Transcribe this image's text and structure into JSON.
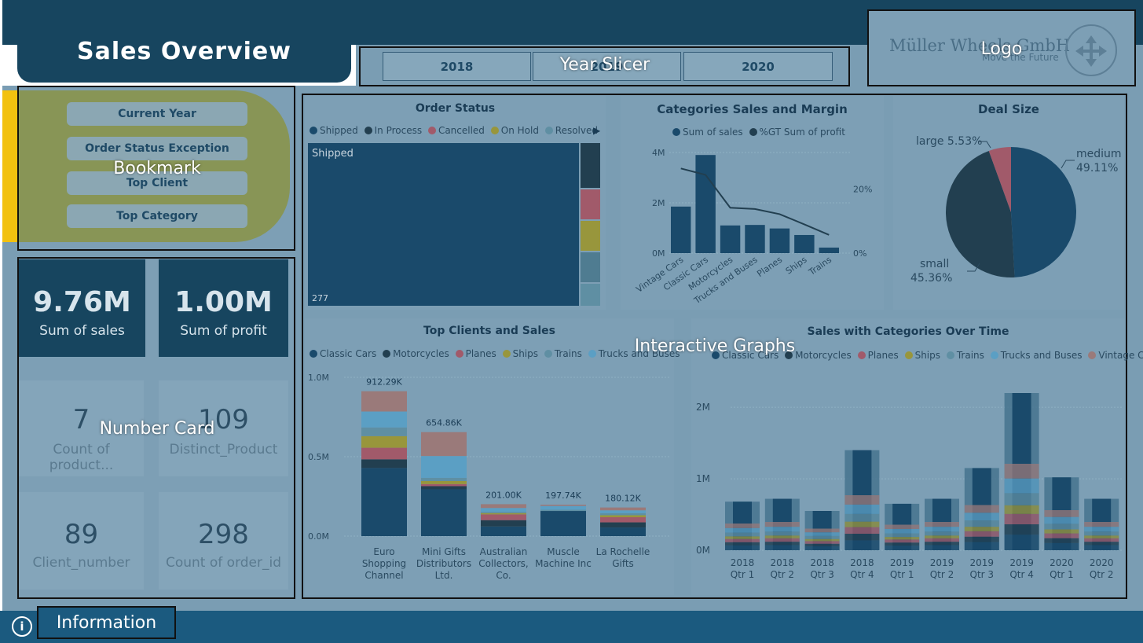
{
  "header": {
    "title": "Sales Overview"
  },
  "year_slicer": {
    "buttons": [
      "2018",
      "2019",
      "2020"
    ],
    "annotation": "Year Slicer"
  },
  "logo": {
    "company": "Müller Wheels GmbH",
    "tagline": "Move the Future",
    "annotation": "Logo"
  },
  "bookmarks": {
    "buttons": [
      "Current Year",
      "Order Status Exception",
      "Top Client",
      "Top Category"
    ],
    "annotation": "Bookmark"
  },
  "cards": {
    "annotation": "Number Card",
    "items": [
      {
        "value": "9.76M",
        "label": "Sum of sales"
      },
      {
        "value": "1.00M",
        "label": "Sum of profit"
      },
      {
        "value": "7",
        "label": "Count of product..."
      },
      {
        "value": "109",
        "label": "Distinct_Product"
      },
      {
        "value": "89",
        "label": "Client_number"
      },
      {
        "value": "298",
        "label": "Count of order_id"
      }
    ]
  },
  "graphs_annotation": "Interactive Graphs",
  "footer": {
    "info_label": "Information",
    "info_icon": "info-icon"
  },
  "colors": {
    "dark_blue": "#17455f",
    "accent_yellow": "#f2c10f",
    "shipped": "#1a4a6b",
    "in_process": "#223f50",
    "cancelled": "#a15a6a",
    "on_hold": "#98963c",
    "resolved": "#5f8fa3"
  },
  "chart_data": [
    {
      "type": "treemap",
      "title": "Order Status",
      "legend": [
        "Shipped",
        "In Process",
        "Cancelled",
        "On Hold",
        "Resolved"
      ],
      "labels": {
        "main": "Shipped",
        "count": "277"
      }
    },
    {
      "type": "bar",
      "title": "Categories Sales and Margin",
      "legend": [
        "Sum of sales",
        "%GT Sum of profit"
      ],
      "categories": [
        "Vintage Cars",
        "Classic Cars",
        "Motorcycles",
        "Trucks and Buses",
        "Planes",
        "Ships",
        "Trains"
      ],
      "series": [
        {
          "name": "Sum of sales",
          "values": [
            1.85,
            3.9,
            1.1,
            1.12,
            0.98,
            0.72,
            0.22
          ]
        },
        {
          "name": "%GT Sum of profit",
          "values": [
            26.5,
            24.5,
            14.2,
            13.8,
            12.2,
            9.0,
            5.7
          ]
        }
      ],
      "y_ticks": [
        "0M",
        "2M",
        "4M"
      ],
      "y2_ticks": [
        "0%",
        "20%"
      ],
      "ylim": [
        0,
        4
      ],
      "y2lim": [
        0,
        31.5
      ]
    },
    {
      "type": "pie",
      "title": "Deal Size",
      "slices": [
        {
          "name": "medium",
          "value": 49.11,
          "label": "medium 49.11%"
        },
        {
          "name": "small",
          "value": 45.36,
          "label": "small 45.36%"
        },
        {
          "name": "large",
          "value": 5.53,
          "label": "large 5.53%"
        }
      ],
      "label_texts": [
        "medium",
        "49.11%",
        "small",
        "45.36%",
        "large 5.53%"
      ]
    },
    {
      "type": "bar",
      "title": "Top Clients and Sales",
      "legend": [
        "Classic Cars",
        "Motorcycles",
        "Planes",
        "Ships",
        "Trains",
        "Trucks and Buses"
      ],
      "categories": [
        [
          "Euro",
          "Shopping",
          "Channel"
        ],
        [
          "Mini Gifts",
          "Distributors",
          "Ltd."
        ],
        [
          "Australian",
          "Collectors,",
          "Co."
        ],
        [
          "Muscle",
          "Machine Inc"
        ],
        [
          "La Rochelle",
          "Gifts"
        ]
      ],
      "totals": [
        "912.29K",
        "654.86K",
        "201.00K",
        "197.74K",
        "180.12K"
      ],
      "total_values": [
        912.29,
        654.86,
        201.0,
        197.74,
        180.12
      ],
      "y_ticks": [
        "0.0M",
        "0.5M",
        "1.0M"
      ],
      "ylim": [
        0,
        1000
      ]
    },
    {
      "type": "area",
      "title": "Sales with Categories Over Time",
      "legend": [
        "Classic Cars",
        "Motorcycles",
        "Planes",
        "Ships",
        "Trains",
        "Trucks and Buses",
        "Vintage Cars"
      ],
      "x": [
        [
          "2018",
          "Qtr 1"
        ],
        [
          "2018",
          "Qtr 2"
        ],
        [
          "2018",
          "Qtr 3"
        ],
        [
          "2018",
          "Qtr 4"
        ],
        [
          "2019",
          "Qtr 1"
        ],
        [
          "2019",
          "Qtr 2"
        ],
        [
          "2019",
          "Qtr 3"
        ],
        [
          "2019",
          "Qtr 4"
        ],
        [
          "2020",
          "Qtr 1"
        ],
        [
          "2020",
          "Qtr 2"
        ]
      ],
      "totals": [
        0.68,
        0.72,
        0.55,
        1.4,
        0.65,
        0.72,
        1.15,
        2.2,
        1.02,
        0.72
      ],
      "y_ticks": [
        "0M",
        "1M",
        "2M"
      ],
      "ylim": [
        0,
        2.2
      ]
    }
  ]
}
